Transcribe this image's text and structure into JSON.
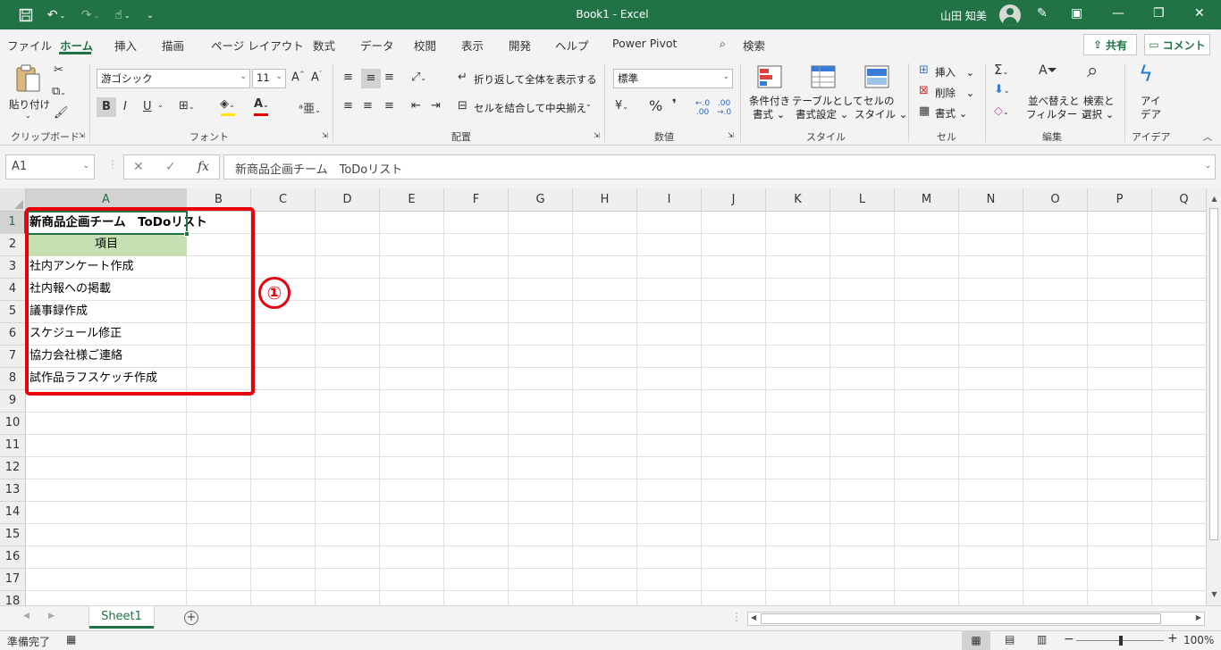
{
  "window": {
    "title": "Book1  -  Excel",
    "user_name": "山田 知美"
  },
  "ribbon_tabs": [
    "ファイル",
    "ホーム",
    "挿入",
    "描画",
    "ページ レイアウト",
    "数式",
    "データ",
    "校閲",
    "表示",
    "開発",
    "ヘルプ",
    "Power Pivot",
    "検索"
  ],
  "header_buttons": {
    "share": "共有",
    "comment": "コメント"
  },
  "ribbon": {
    "clipboard": {
      "paste": "貼り付け",
      "label": "クリップボード"
    },
    "font": {
      "name": "游ゴシック",
      "size": "11",
      "label": "フォント",
      "bold": "B",
      "italic": "I",
      "underline": "U"
    },
    "alignment": {
      "wrap": "折り返して全体を表示する",
      "merge": "セルを結合して中央揃え",
      "label": "配置"
    },
    "number": {
      "format": "標準",
      "percent": "%",
      "comma": "❜",
      "label": "数値"
    },
    "styles": {
      "cond_line1": "条件付き",
      "cond_line2": "書式",
      "table_line1": "テーブルとして",
      "table_line2": "書式設定",
      "cell_line1": "セルの",
      "cell_line2": "スタイル",
      "label": "スタイル"
    },
    "cells": {
      "insert": "挿入",
      "delete": "削除",
      "format": "書式",
      "label": "セル"
    },
    "editing": {
      "sort_line1": "並べ替えと",
      "sort_line2": "フィルター",
      "find_line1": "検索と",
      "find_line2": "選択",
      "label": "編集"
    },
    "ideas": {
      "line1": "アイ",
      "line2": "デア",
      "label": "アイデア"
    }
  },
  "formula_bar": {
    "name_box": "A1",
    "fx": "fx",
    "content": "新商品企画チーム　ToDoリスト"
  },
  "columns": [
    "A",
    "B",
    "C",
    "D",
    "E",
    "F",
    "G",
    "H",
    "I",
    "J",
    "K",
    "L",
    "M",
    "N",
    "O",
    "P",
    "Q"
  ],
  "rows": [
    "1",
    "2",
    "3",
    "4",
    "5",
    "6",
    "7",
    "8",
    "9",
    "10",
    "11",
    "12",
    "13",
    "14",
    "15",
    "16",
    "17",
    "18"
  ],
  "cells": {
    "A1": "新商品企画チーム　ToDoリスト",
    "A2": "項目",
    "A3": "社内アンケート作成",
    "A4": "社内報への掲載",
    "A5": "議事録作成",
    "A6": "スケジュール修正",
    "A7": "協力会社様ご連絡",
    "A8": "試作品ラフスケッチ作成"
  },
  "annotation": {
    "marker": "①",
    "color": "#e8000b"
  },
  "sheet_tabs": [
    "Sheet1"
  ],
  "status": {
    "ready": "準備完了",
    "zoom": "100%"
  },
  "colors": {
    "excel_green": "#217346",
    "header_fill": "#c6e0b4"
  }
}
